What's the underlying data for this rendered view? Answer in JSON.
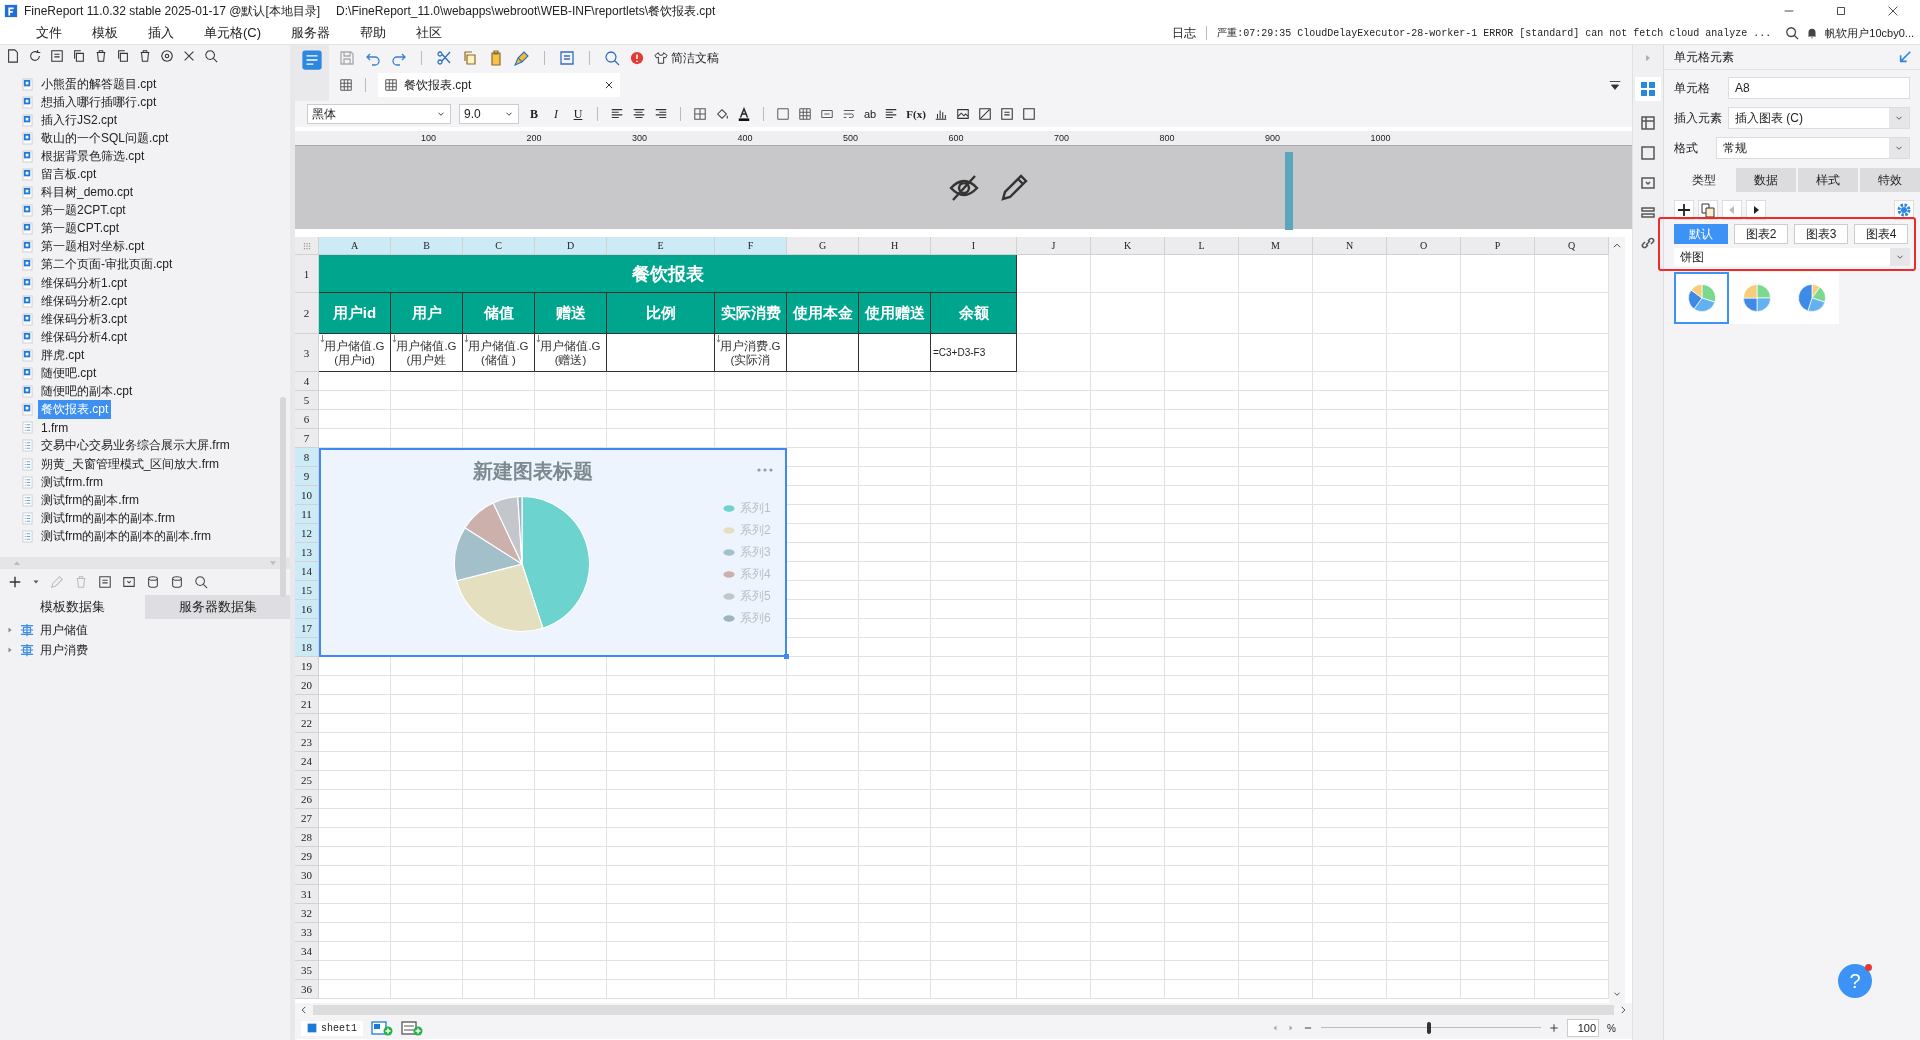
{
  "window": {
    "title": "FineReport 11.0.32 stable 2025-01-17 @默认[本地目录]",
    "path": "D:\\FineReport_11.0\\webapps\\webroot\\WEB-INF\\reportlets\\餐饮报表.cpt"
  },
  "menu": [
    "文件",
    "模板",
    "插入",
    "单元格(C)",
    "服务器",
    "帮助",
    "社区"
  ],
  "log": {
    "label": "日志",
    "message": "严重:07:29:35 CloudDelayExecutor-28-worker-1 ERROR [standard] can not fetch cloud analyze ..."
  },
  "user": "帆软用户10cby0...",
  "file_tree": [
    {
      "name": "小熊蛋的解答题目.cpt",
      "kind": "cpt",
      "selected": false
    },
    {
      "name": "想插入哪行插哪行.cpt",
      "kind": "cpt",
      "selected": false
    },
    {
      "name": "插入行JS2.cpt",
      "kind": "cpt",
      "selected": false
    },
    {
      "name": "敬山的一个SQL问题.cpt",
      "kind": "cpt",
      "selected": false
    },
    {
      "name": "根据背景色筛选.cpt",
      "kind": "cpt",
      "selected": false
    },
    {
      "name": "留言板.cpt",
      "kind": "cpt",
      "selected": false
    },
    {
      "name": "科目树_demo.cpt",
      "kind": "cpt",
      "selected": false
    },
    {
      "name": "第一题2CPT.cpt",
      "kind": "cpt",
      "selected": false
    },
    {
      "name": "第一题CPT.cpt",
      "kind": "cpt",
      "selected": false
    },
    {
      "name": "第一题相对坐标.cpt",
      "kind": "cpt",
      "selected": false
    },
    {
      "name": "第二个页面-审批页面.cpt",
      "kind": "cpt",
      "selected": false
    },
    {
      "name": "维保码分析1.cpt",
      "kind": "cpt",
      "selected": false
    },
    {
      "name": "维保码分析2.cpt",
      "kind": "cpt",
      "selected": false
    },
    {
      "name": "维保码分析3.cpt",
      "kind": "cpt",
      "selected": false
    },
    {
      "name": "维保码分析4.cpt",
      "kind": "cpt",
      "selected": false
    },
    {
      "name": "胖虎.cpt",
      "kind": "cpt",
      "selected": false
    },
    {
      "name": "随便吧.cpt",
      "kind": "cpt",
      "selected": false
    },
    {
      "name": "随便吧的副本.cpt",
      "kind": "cpt",
      "selected": false
    },
    {
      "name": "餐饮报表.cpt",
      "kind": "cpt",
      "selected": true
    },
    {
      "name": "1.frm",
      "kind": "frm",
      "selected": false
    },
    {
      "name": "交易中心交易业务综合展示大屏.frm",
      "kind": "frm",
      "selected": false
    },
    {
      "name": "朔黄_天窗管理模式_区间放大.frm",
      "kind": "frm",
      "selected": false
    },
    {
      "name": "测试frm.frm",
      "kind": "frm",
      "selected": false
    },
    {
      "name": "测试frm的副本.frm",
      "kind": "frm",
      "selected": false
    },
    {
      "name": "测试frm的副本的副本.frm",
      "kind": "frm",
      "selected": false
    },
    {
      "name": "测试frm的副本的副本的副本.frm",
      "kind": "frm",
      "selected": false
    }
  ],
  "dataset_tabs": [
    {
      "label": "模板数据集",
      "selected": true
    },
    {
      "label": "服务器数据集",
      "selected": false
    }
  ],
  "datasets": [
    "用户储值",
    "用户消费"
  ],
  "toolbar": {
    "simple_doc": "简洁文稿"
  },
  "editor_tab": "餐饮报表.cpt",
  "format_bar": {
    "font": "黑体",
    "size": "9.0",
    "styles": [
      "B",
      "I",
      "U"
    ],
    "text_tools": [
      "ab",
      "F(x)"
    ]
  },
  "ruler": [
    "100",
    "200",
    "300",
    "400",
    "500",
    "600",
    "700",
    "800",
    "900",
    "1000"
  ],
  "sheet": {
    "columns": [
      {
        "label": "A",
        "selected": true
      },
      {
        "label": "B",
        "selected": true
      },
      {
        "label": "C",
        "selected": true
      },
      {
        "label": "D",
        "selected": true
      },
      {
        "label": "E",
        "selected": true
      },
      {
        "label": "F",
        "selected": true
      },
      {
        "label": "G",
        "selected": false
      },
      {
        "label": "H",
        "selected": false
      },
      {
        "label": "I",
        "selected": false
      },
      {
        "label": "J",
        "selected": false
      },
      {
        "label": "K",
        "selected": false
      },
      {
        "label": "L",
        "selected": false
      },
      {
        "label": "M",
        "selected": false
      },
      {
        "label": "N",
        "selected": false
      },
      {
        "label": "O",
        "selected": false
      },
      {
        "label": "P",
        "selected": false
      },
      {
        "label": "Q",
        "selected": false
      }
    ],
    "rows": [
      {
        "label": "1",
        "selected": false,
        "cells": [
          {
            "kind": "title",
            "text": "餐饮报表"
          }
        ]
      },
      {
        "label": "2",
        "selected": false,
        "cells": [
          {
            "kind": "header",
            "text": "用户id"
          },
          {
            "kind": "header",
            "text": "用户"
          },
          {
            "kind": "header",
            "text": "储值"
          },
          {
            "kind": "header",
            "text": "赠送"
          },
          {
            "kind": "header",
            "text": "比例"
          },
          {
            "kind": "header",
            "text": "实际消费"
          },
          {
            "kind": "header",
            "text": "使用本金"
          },
          {
            "kind": "header",
            "text": "使用赠送"
          },
          {
            "kind": "header",
            "text": "余额"
          }
        ]
      },
      {
        "label": "3",
        "selected": false,
        "cells": [
          {
            "kind": "expand",
            "text": "用户储值.G(用户id)"
          },
          {
            "kind": "expand",
            "text": "用户储值.G(用户姓"
          },
          {
            "kind": "expand",
            "text": "用户储值.G(储值 )"
          },
          {
            "kind": "expand",
            "text": "用户储值.G(赠送)"
          },
          {
            "kind": "blank"
          },
          {
            "kind": "expand",
            "text": "用户消费.G(实际消"
          },
          {
            "kind": "blank"
          },
          {
            "kind": "blank"
          },
          {
            "kind": "formula",
            "text": "=C3+D3-F3"
          }
        ]
      },
      {
        "label": "4",
        "selected": false
      },
      {
        "label": "5",
        "selected": false
      },
      {
        "label": "6",
        "selected": false
      },
      {
        "label": "7",
        "selected": false
      },
      {
        "label": "8",
        "selected": true
      },
      {
        "label": "9",
        "selected": true
      },
      {
        "label": "10",
        "selected": true
      },
      {
        "label": "11",
        "selected": true
      },
      {
        "label": "12",
        "selected": true
      },
      {
        "label": "13",
        "selected": true
      },
      {
        "label": "14",
        "selected": true
      },
      {
        "label": "15",
        "selected": true
      },
      {
        "label": "16",
        "selected": true
      },
      {
        "label": "17",
        "selected": true
      },
      {
        "label": "18",
        "selected": true
      },
      {
        "label": "19",
        "selected": false
      },
      {
        "label": "20",
        "selected": false
      },
      {
        "label": "21",
        "selected": false
      },
      {
        "label": "22",
        "selected": false
      },
      {
        "label": "23",
        "selected": false
      },
      {
        "label": "24",
        "selected": false
      },
      {
        "label": "25",
        "selected": false
      },
      {
        "label": "26",
        "selected": false
      },
      {
        "label": "27",
        "selected": false
      },
      {
        "label": "28",
        "selected": false
      },
      {
        "label": "29",
        "selected": false
      },
      {
        "label": "30",
        "selected": false
      },
      {
        "label": "31",
        "selected": false
      },
      {
        "label": "32",
        "selected": false
      },
      {
        "label": "33",
        "selected": false
      },
      {
        "label": "34",
        "selected": false
      },
      {
        "label": "35",
        "selected": false
      },
      {
        "label": "36",
        "selected": false
      }
    ]
  },
  "chart": {
    "title": "新建图表标题",
    "legend": [
      {
        "name": "系列1",
        "color": "#6dd3cf"
      },
      {
        "name": "系列2",
        "color": "#e3dfbf"
      },
      {
        "name": "系列3",
        "color": "#a2bfca"
      },
      {
        "name": "系列4",
        "color": "#ccb0ab"
      },
      {
        "name": "系列5",
        "color": "#c3c6ca"
      },
      {
        "name": "系列6",
        "color": "#9fb4c0"
      }
    ]
  },
  "sheet_tabs": [
    "sheet1"
  ],
  "zoom": {
    "value": "100",
    "unit": "%",
    "level": 0.49
  },
  "cell_panel": {
    "title": "单元格元素",
    "fields": [
      {
        "label": "单元格",
        "value": "A8",
        "kind": "input"
      },
      {
        "label": "插入元素",
        "value": "插入图表 (C)",
        "kind": "select"
      },
      {
        "label": "格式",
        "value": "常规",
        "kind": "select"
      }
    ],
    "tabs": [
      {
        "label": "类型",
        "selected": true
      },
      {
        "label": "数据",
        "selected": false
      },
      {
        "label": "样式",
        "selected": false
      },
      {
        "label": "特效",
        "selected": false
      }
    ],
    "chart_tabs": [
      {
        "label": "默认",
        "selected": true
      },
      {
        "label": "图表2",
        "selected": false
      },
      {
        "label": "图表3",
        "selected": false
      },
      {
        "label": "图表4",
        "selected": false
      }
    ],
    "chart_type": "饼图",
    "thumbnails": [
      {
        "selected": true
      },
      {
        "selected": false
      },
      {
        "selected": false
      }
    ]
  },
  "help": "?"
}
